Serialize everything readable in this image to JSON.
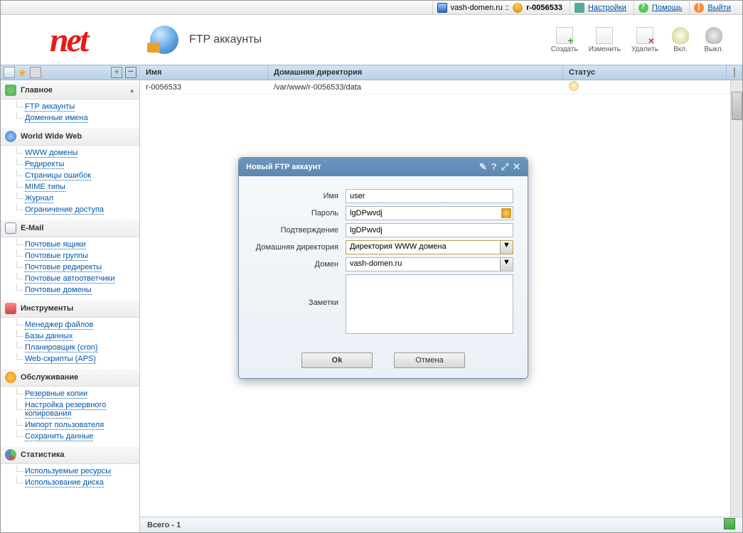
{
  "topbar": {
    "domain": "vash-domen.ru ::",
    "account": "r-0056533",
    "settings": "Настройки",
    "help": "Помощь",
    "exit": "Выйти"
  },
  "header": {
    "logo_text": "net",
    "title": "FTP аккаунты"
  },
  "toolbar": {
    "create": "Создать",
    "edit": "Изменить",
    "delete": "Удалить",
    "on": "Вкл.",
    "off": "Выкл."
  },
  "sidebar": {
    "groups": [
      {
        "label": "Главное",
        "icon": "ic-home",
        "items": [
          "FTP аккаунты",
          "Доменные имена"
        ]
      },
      {
        "label": "World Wide Web",
        "icon": "ic-www",
        "items": [
          "WWW домены",
          "Редиректы",
          "Страницы ошибок",
          "MIME типы",
          "Журнал",
          "Ограничение доступа"
        ]
      },
      {
        "label": "E-Mail",
        "icon": "ic-mail",
        "items": [
          "Почтовые ящики",
          "Почтовые группы",
          "Почтовые редиректы",
          "Почтовые автоответчики",
          "Почтовые домены"
        ]
      },
      {
        "label": "Инструменты",
        "icon": "ic-tools",
        "items": [
          "Менеджер файлов",
          "Базы данных",
          "Планировщик (cron)",
          "Web-скрипты (APS)"
        ]
      },
      {
        "label": "Обслуживание",
        "icon": "ic-service",
        "items": [
          "Резервные копии",
          "Настройка резервного копирования",
          "Импорт пользователя",
          "Сохранить данные"
        ]
      },
      {
        "label": "Статистика",
        "icon": "ic-stats",
        "items": [
          "Используемые ресурсы",
          "Использование диска"
        ]
      }
    ]
  },
  "table": {
    "headers": {
      "name": "Имя",
      "dir": "Домашняя директория",
      "status": "Статус"
    },
    "rows": [
      {
        "name": "r-0056533",
        "dir": "/var/www/r-0056533/data"
      }
    ],
    "footer": "Всего - 1"
  },
  "dialog": {
    "title": "Новый FTP аккаунт",
    "labels": {
      "name": "Имя",
      "password": "Пароль",
      "confirm": "Подтверждение",
      "homedir": "Домашняя директория",
      "domain": "Домен",
      "notes": "Заметки"
    },
    "values": {
      "name": "user",
      "password": "lgDPwvdj",
      "confirm": "lgDPwvdj",
      "homedir": "Директория WWW домена",
      "domain": "vash-domen.ru",
      "notes": ""
    },
    "buttons": {
      "ok": "Ok",
      "cancel": "Отмена"
    }
  }
}
